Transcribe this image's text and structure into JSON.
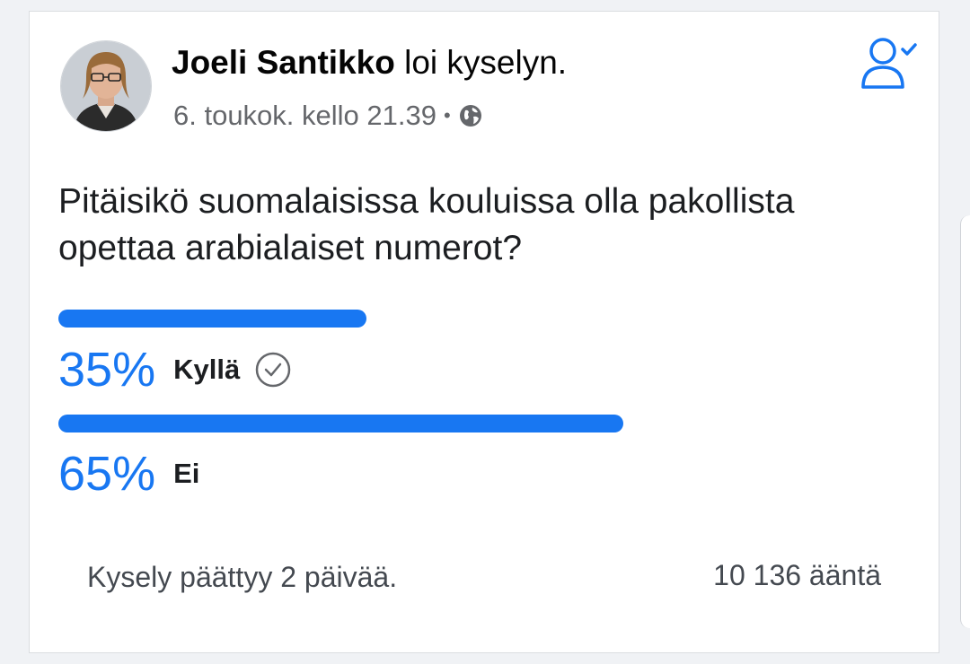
{
  "post": {
    "author_name": "Joeli Santikko",
    "action_text": " loi kyselyn.",
    "timestamp": "6. toukok. kello 21.39",
    "separator": "•",
    "privacy_icon": "globe-icon",
    "follow_icon": "person-check-icon"
  },
  "poll": {
    "question": "Pitäisikö suomalaisissa kouluissa olla pakollista opettaa arabialaiset numerot?",
    "options": [
      {
        "percent_text": "35%",
        "label": "Kyllä",
        "share": 0.35,
        "selected": true
      },
      {
        "percent_text": "65%",
        "label": "Ei",
        "share": 0.65,
        "selected": false
      }
    ],
    "ends_text": "Kysely päättyy 2 päivää.",
    "votes_text": "10 136 ääntä"
  },
  "colors": {
    "accent": "#1877f2",
    "text_primary": "#1c1e21",
    "text_secondary": "#65676b"
  }
}
